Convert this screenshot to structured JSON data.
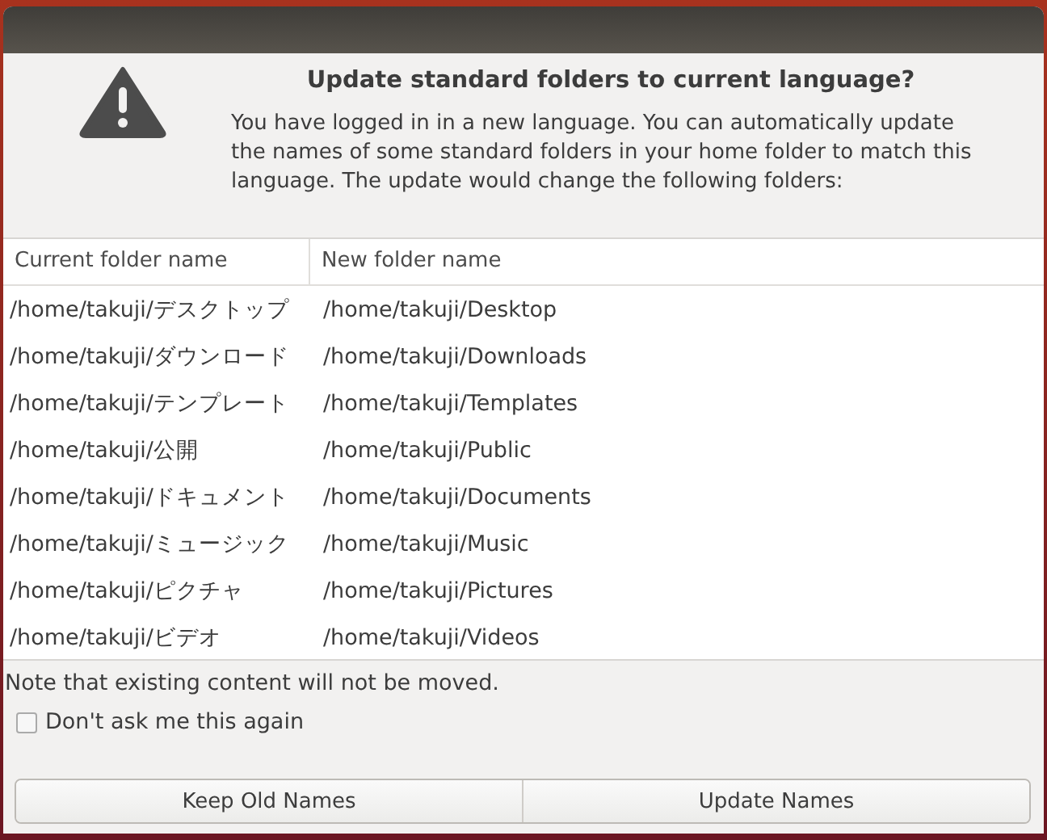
{
  "dialog": {
    "title": "Update standard folders to current language?",
    "message": "You have logged in in a new language. You can automatically update the names of some standard folders in your home folder to match this language. The update would change the following folders:"
  },
  "table": {
    "columns": [
      "Current folder name",
      "New folder name"
    ],
    "rows": [
      [
        "/home/takuji/デスクトップ",
        "/home/takuji/Desktop"
      ],
      [
        "/home/takuji/ダウンロード",
        "/home/takuji/Downloads"
      ],
      [
        "/home/takuji/テンプレート",
        "/home/takuji/Templates"
      ],
      [
        "/home/takuji/公開",
        "/home/takuji/Public"
      ],
      [
        "/home/takuji/ドキュメント",
        "/home/takuji/Documents"
      ],
      [
        "/home/takuji/ミュージック",
        "/home/takuji/Music"
      ],
      [
        "/home/takuji/ピクチャ",
        "/home/takuji/Pictures"
      ],
      [
        "/home/takuji/ビデオ",
        "/home/takuji/Videos"
      ]
    ]
  },
  "note": "Note that existing content will not be moved.",
  "dont_ask": {
    "label": "Don't ask me this again",
    "checked": false
  },
  "buttons": [
    "Keep Old Names",
    "Update Names"
  ]
}
